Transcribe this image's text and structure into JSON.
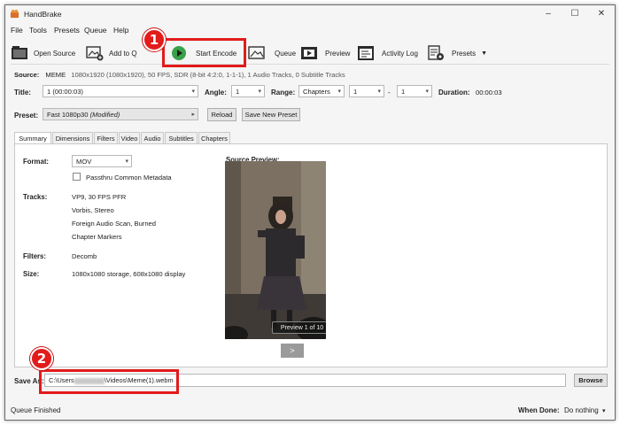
{
  "window": {
    "title": "HandBrake",
    "controls": [
      "–",
      "☐",
      "✕"
    ]
  },
  "menu": [
    "File",
    "Tools",
    "Presets",
    "Queue",
    "Help"
  ],
  "toolbar": {
    "open_source": "Open Source",
    "add_to_queue": "Add to Q",
    "start_encode": "Start Encode",
    "queue": "Queue",
    "preview": "Preview",
    "activity_log": "Activity Log",
    "presets": "Presets"
  },
  "source": {
    "label": "Source:",
    "name": "MEME",
    "details": "1080x1920 (1080x1920), 50 FPS, SDR (8-bit 4:2:0, 1-1-1), 1 Audio Tracks, 0 Subtitle Tracks"
  },
  "title_row": {
    "title_label": "Title:",
    "title_value": "1 (00:00:03)",
    "angle_label": "Angle:",
    "angle_value": "1",
    "range_label": "Range:",
    "range_value": "Chapters",
    "range_start": "1",
    "range_dash": "-",
    "range_end": "1",
    "duration_label": "Duration:",
    "duration_value": "00:00:03"
  },
  "preset_row": {
    "label": "Preset:",
    "value": "Fast 1080p30",
    "modified": "(Modified)",
    "reload": "Reload",
    "save_new": "Save New Preset"
  },
  "tabs": [
    "Summary",
    "Dimensions",
    "Filters",
    "Video",
    "Audio",
    "Subtitles",
    "Chapters"
  ],
  "summary": {
    "format_label": "Format:",
    "format_value": "MOV",
    "passthru": "Passthru Common Metadata",
    "tracks_label": "Tracks:",
    "tracks": [
      "VP9, 30 FPS PFR",
      "Vorbis, Stereo",
      "Foreign Audio Scan, Burned",
      "Chapter Markers"
    ],
    "filters_label": "Filters:",
    "filters_value": "Decomb",
    "size_label": "Size:",
    "size_value": "1080x1080 storage, 608x1080 display",
    "preview_label": "Source Preview:",
    "preview_caption": "Preview 1 of 10",
    "next": ">"
  },
  "save_as": {
    "label": "Save As:",
    "path_prefix": "C:\\Users",
    "path_suffix": "\\Videos\\Meme(1).webm",
    "browse": "Browse"
  },
  "status": {
    "text": "Queue Finished",
    "when_done_label": "When Done:",
    "when_done_value": "Do nothing"
  },
  "callouts": [
    "1",
    "2"
  ],
  "colors": {
    "callout": "#e21b1b",
    "play_green": "#3aa04a"
  }
}
